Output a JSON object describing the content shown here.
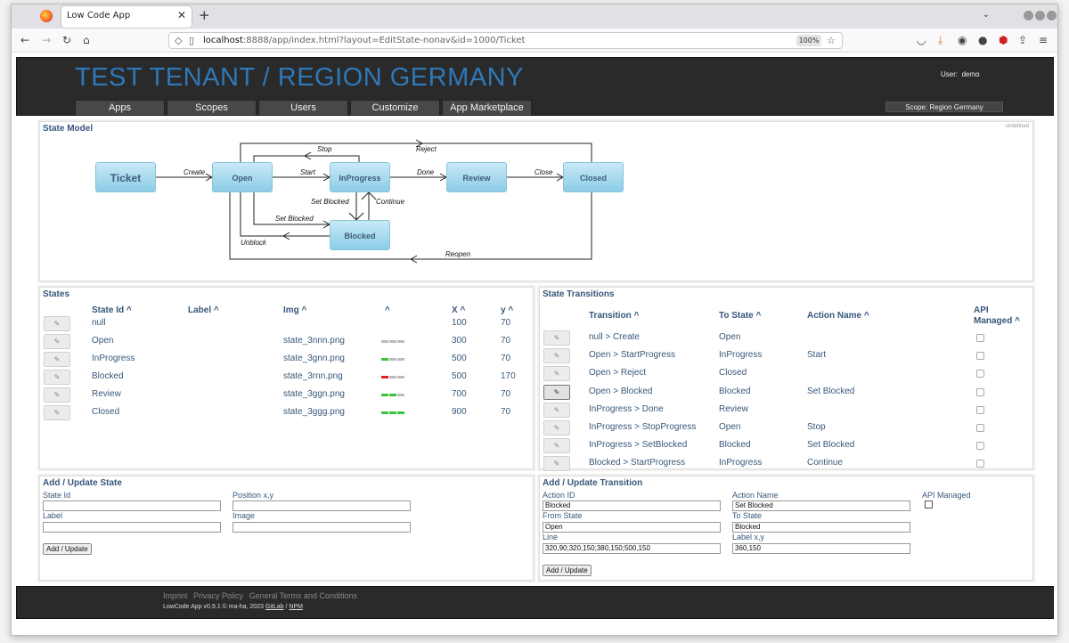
{
  "browser": {
    "tab_title": "Low Code App",
    "url_host": "localhost",
    "url_rest": ":8888/app/index.html?layout=EditState-nonav&id=1000/Ticket",
    "zoom": "100%"
  },
  "header": {
    "title": "TEST TENANT / REGION GERMANY",
    "user_label": "User:",
    "user_name": "demo",
    "scope": "Scope: Region Germany",
    "nav": [
      "Apps",
      "Scopes",
      "Users",
      "Customize",
      "App Marketplace"
    ]
  },
  "state_model": {
    "title": "State Model",
    "undefined_text": "undefined",
    "states": [
      "Ticket",
      "Open",
      "InProgress",
      "Review",
      "Closed",
      "Blocked"
    ],
    "edges": [
      "Create",
      "Start",
      "Stop",
      "Done",
      "Close",
      "Reject",
      "Set Blocked",
      "Continue",
      "Set Blocked",
      "Unblock",
      "Reopen"
    ]
  },
  "states": {
    "title": "States",
    "headers": [
      "State Id ^",
      "Label ^",
      "Img ^",
      "^",
      "X ^",
      "y ^"
    ],
    "rows": [
      {
        "id": "null",
        "label": "",
        "img": "",
        "dots": [],
        "x": "100",
        "y": "70"
      },
      {
        "id": "Open",
        "label": "",
        "img": "state_3nnn.png",
        "dots": [
          "#bbbbbb",
          "#bbbbbb",
          "#bbbbbb"
        ],
        "x": "300",
        "y": "70"
      },
      {
        "id": "InProgress",
        "label": "",
        "img": "state_3gnn.png",
        "dots": [
          "#3ac43a",
          "#bbbbbb",
          "#bbbbbb"
        ],
        "x": "500",
        "y": "70"
      },
      {
        "id": "Blocked",
        "label": "",
        "img": "state_3rnn.png",
        "dots": [
          "#e02020",
          "#bbbbbb",
          "#bbbbbb"
        ],
        "x": "500",
        "y": "170"
      },
      {
        "id": "Review",
        "label": "",
        "img": "state_3ggn.png",
        "dots": [
          "#3ac43a",
          "#3ac43a",
          "#bbbbbb"
        ],
        "x": "700",
        "y": "70"
      },
      {
        "id": "Closed",
        "label": "",
        "img": "state_3ggg.png",
        "dots": [
          "#3ac43a",
          "#3ac43a",
          "#3ac43a"
        ],
        "x": "900",
        "y": "70"
      }
    ]
  },
  "transitions": {
    "title": "State Transitions",
    "headers": [
      "Transition ^",
      "To State ^",
      "Action Name ^",
      "API",
      "Managed ^"
    ],
    "rows": [
      {
        "transition": "null > Create",
        "to": "Open",
        "action": ""
      },
      {
        "transition": "Open > StartProgress",
        "to": "InProgress",
        "action": "Start"
      },
      {
        "transition": "Open > Reject",
        "to": "Closed",
        "action": ""
      },
      {
        "transition": "Open > Blocked",
        "to": "Blocked",
        "action": "Set Blocked"
      },
      {
        "transition": "InProgress > Done",
        "to": "Review",
        "action": ""
      },
      {
        "transition": "InProgress > StopProgress",
        "to": "Open",
        "action": "Stop"
      },
      {
        "transition": "InProgress > SetBlocked",
        "to": "Blocked",
        "action": "Set Blocked"
      },
      {
        "transition": "Blocked > StartProgress",
        "to": "InProgress",
        "action": "Continue"
      }
    ]
  },
  "add_state": {
    "title": "Add / Update State",
    "state_id_label": "State Id",
    "position_label": "Position x,y",
    "label_label": "Label",
    "image_label": "Image",
    "button": "Add / Update"
  },
  "add_transition": {
    "title": "Add / Update Transition",
    "action_id_label": "Action ID",
    "action_id_value": "Blocked",
    "action_name_label": "Action Name",
    "action_name_value": "Set Blocked",
    "api_managed_label": "API Managed",
    "from_state_label": "From State",
    "from_state_value": "Open",
    "to_state_label": "To State",
    "to_state_value": "Blocked",
    "line_label": "Line",
    "line_value": "320,90;320,150;380,150;500,150",
    "label_xy_label": "Label x,y",
    "label_xy_value": "360,150",
    "button": "Add / Update"
  },
  "footer": {
    "links": [
      "Imprint",
      "Privacy Policy",
      "General Terms and Conditions"
    ],
    "copyright": "LowCode App v0.9.1 © ma-ha, 2023",
    "gitlab": "GitLab",
    "separator": "/",
    "npm": "NPM"
  }
}
